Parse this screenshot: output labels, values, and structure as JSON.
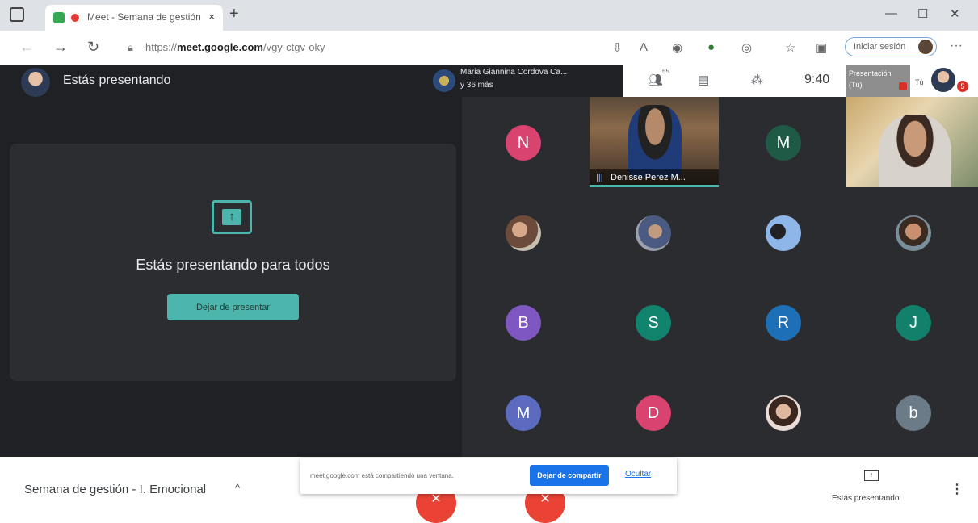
{
  "browser": {
    "tab_title": "Meet - Semana de gestión",
    "tab_close": "×",
    "new_tab": "+",
    "url_prefix": "https://",
    "url_host": "meet.google.com",
    "url_path": "/vgy-ctgv-oky",
    "signin_label": "Iniciar sesión",
    "more": "···",
    "window_controls": [
      "—",
      "☐",
      "✕"
    ],
    "icons": [
      "back-icon",
      "forward-icon",
      "reload-icon",
      "lock-icon",
      "download-icon",
      "extensions-icon",
      "favorites-icon",
      "collections-icon",
      "profile-icon"
    ]
  },
  "meet": {
    "presenting_heading": "Estás presentando",
    "presenting_message": "Estás presentando para todos",
    "stop_presenting_label": "Dejar de presentar",
    "speaker": {
      "name_line1": "Maria Giannina Cordova Ca...",
      "name_line2": "y 36 más"
    },
    "people_count": "55",
    "time": "9:40",
    "presentation_tile": {
      "line1": "Presentación",
      "line2": "(Tú)"
    },
    "self_label": "Tú",
    "self_badge": "5",
    "video_name": "Denisse Perez M...",
    "participants": [
      {
        "type": "letter",
        "letter": "N",
        "color": "#d94370"
      },
      {
        "type": "video"
      },
      {
        "type": "letter",
        "letter": "M",
        "color": "#1f5a46"
      },
      {
        "type": "video"
      },
      {
        "type": "photo"
      },
      {
        "type": "photo"
      },
      {
        "type": "photo"
      },
      {
        "type": "photo"
      },
      {
        "type": "letter",
        "letter": "B",
        "color": "#7e57c2"
      },
      {
        "type": "letter",
        "letter": "S",
        "color": "#12836d"
      },
      {
        "type": "letter",
        "letter": "R",
        "color": "#1d6fb8"
      },
      {
        "type": "letter",
        "letter": "J",
        "color": "#12806a"
      },
      {
        "type": "letter",
        "letter": "M",
        "color": "#5c6bc0"
      },
      {
        "type": "letter",
        "letter": "D",
        "color": "#d94370"
      },
      {
        "type": "photo"
      },
      {
        "type": "letter",
        "letter": "b",
        "color": "#6b7b88"
      }
    ]
  },
  "bottom_bar": {
    "meeting_title": "Semana de gestión - I. Emocional",
    "chevron": "^",
    "share_notice": "meet.google.com está compartiendo una ventana.",
    "stop_sharing_label": "Dejar de compartir",
    "hide_label": "Ocultar",
    "presenting_label": "Estás presentando",
    "more": "⋮"
  },
  "colors": {
    "accent": "#4db6ac",
    "meet_bg": "#202124",
    "link": "#1a73e8",
    "hangup": "#ea4335"
  }
}
